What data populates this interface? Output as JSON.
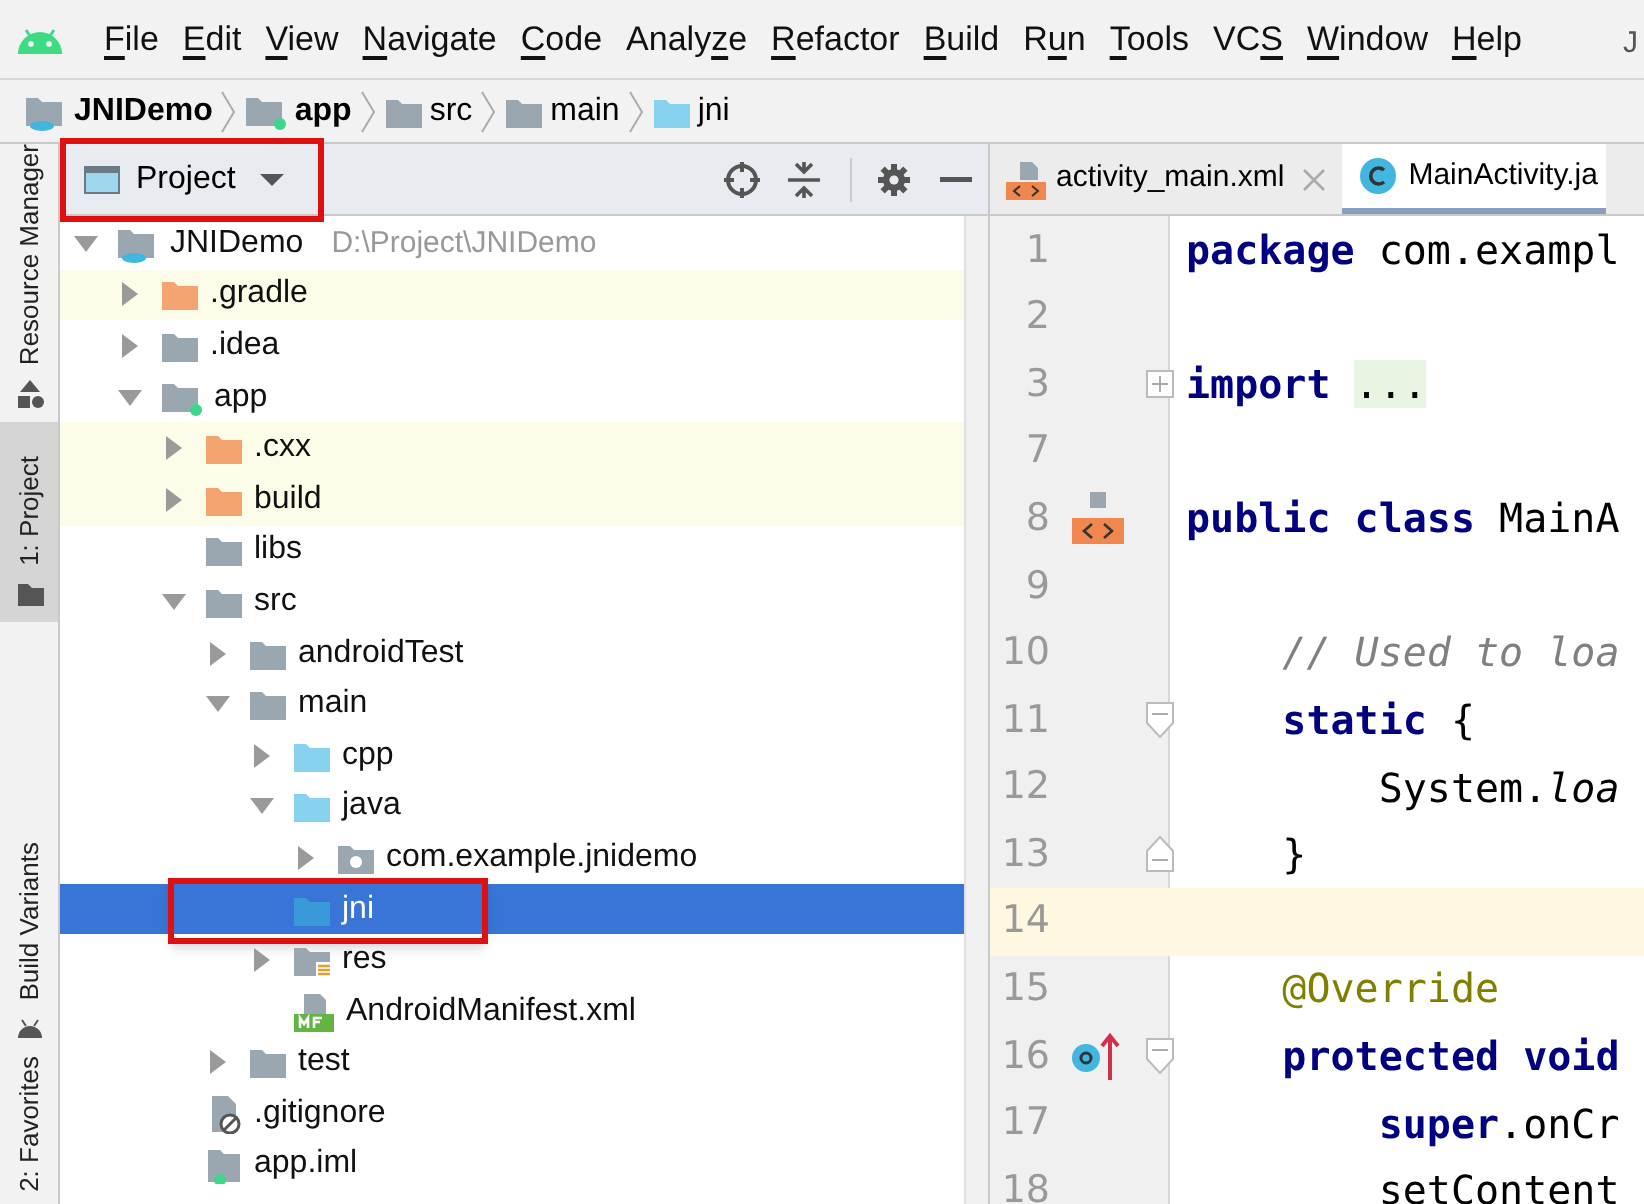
{
  "menu_bar": {
    "items": [
      {
        "parts": [
          {
            "text": "F",
            "underlined": true
          },
          {
            "text": "ile",
            "underlined": false
          }
        ]
      },
      {
        "parts": [
          {
            "text": "E",
            "underlined": true
          },
          {
            "text": "dit",
            "underlined": false
          }
        ]
      },
      {
        "parts": [
          {
            "text": "V",
            "underlined": true
          },
          {
            "text": "iew",
            "underlined": false
          }
        ]
      },
      {
        "parts": [
          {
            "text": "N",
            "underlined": true
          },
          {
            "text": "avigate",
            "underlined": false
          }
        ]
      },
      {
        "parts": [
          {
            "text": "C",
            "underlined": true
          },
          {
            "text": "ode",
            "underlined": false
          }
        ]
      },
      {
        "parts": [
          {
            "text": "Analy",
            "underlined": false
          },
          {
            "text": "z",
            "underlined": true
          },
          {
            "text": "e",
            "underlined": false
          }
        ]
      },
      {
        "parts": [
          {
            "text": "R",
            "underlined": true
          },
          {
            "text": "efactor",
            "underlined": false
          }
        ]
      },
      {
        "parts": [
          {
            "text": "B",
            "underlined": true
          },
          {
            "text": "uild",
            "underlined": false
          }
        ]
      },
      {
        "parts": [
          {
            "text": "R",
            "underlined": false
          },
          {
            "text": "u",
            "underlined": true
          },
          {
            "text": "n",
            "underlined": false
          }
        ]
      },
      {
        "parts": [
          {
            "text": "T",
            "underlined": true
          },
          {
            "text": "ools",
            "underlined": false
          }
        ]
      },
      {
        "parts": [
          {
            "text": "VC",
            "underlined": false
          },
          {
            "text": "S",
            "underlined": true
          }
        ]
      },
      {
        "parts": [
          {
            "text": "W",
            "underlined": true
          },
          {
            "text": "indow",
            "underlined": false
          }
        ]
      },
      {
        "parts": [
          {
            "text": "H",
            "underlined": true
          },
          {
            "text": "elp",
            "underlined": false
          }
        ]
      }
    ],
    "title_fragment": "J"
  },
  "breadcrumb": [
    {
      "label": "JNIDemo",
      "kind": "project",
      "bold": true
    },
    {
      "label": "app",
      "kind": "module",
      "bold": true
    },
    {
      "label": "src",
      "kind": "folder",
      "bold": false
    },
    {
      "label": "main",
      "kind": "folder",
      "bold": false
    },
    {
      "label": "jni",
      "kind": "source",
      "bold": false
    }
  ],
  "left_stripe": [
    {
      "label": "Resource Manager",
      "kind": "shapes",
      "selected": false
    },
    {
      "label": "1: Project",
      "kind": "folder",
      "selected": true
    },
    {
      "label": "Build Variants",
      "kind": "android",
      "selected": false
    },
    {
      "label": "2: Favorites",
      "selected": false
    }
  ],
  "project_panel": {
    "view": "Project",
    "highlighted": true,
    "tree": [
      {
        "label": "JNIDemo",
        "path": "D:\\Project\\JNIDemo",
        "kind": "project",
        "expanded": true,
        "selected": false,
        "children": [
          {
            "label": ".gradle",
            "kind": "excluded",
            "expanded": false,
            "selected": false,
            "excluded": true
          },
          {
            "label": ".idea",
            "kind": "folder",
            "expanded": false,
            "selected": false
          },
          {
            "label": "app",
            "kind": "module",
            "expanded": true,
            "selected": false,
            "children": [
              {
                "label": ".cxx",
                "kind": "excluded",
                "expanded": false,
                "selected": false,
                "excluded": true
              },
              {
                "label": "build",
                "kind": "excluded",
                "expanded": false,
                "selected": false,
                "excluded": true
              },
              {
                "label": "libs",
                "kind": "folder",
                "selected": false
              },
              {
                "label": "src",
                "kind": "folder",
                "expanded": true,
                "selected": false,
                "children": [
                  {
                    "label": "androidTest",
                    "kind": "folder",
                    "expanded": false,
                    "selected": false
                  },
                  {
                    "label": "main",
                    "kind": "folder",
                    "expanded": true,
                    "selected": false,
                    "children": [
                      {
                        "label": "cpp",
                        "kind": "source",
                        "expanded": false,
                        "selected": false
                      },
                      {
                        "label": "java",
                        "kind": "source",
                        "expanded": true,
                        "selected": false,
                        "children": [
                          {
                            "label": "com.example.jnidemo",
                            "kind": "package",
                            "expanded": false,
                            "selected": false
                          }
                        ]
                      },
                      {
                        "label": "jni",
                        "kind": "source",
                        "selected": true,
                        "highlighted": true
                      },
                      {
                        "label": "res",
                        "kind": "resources",
                        "expanded": false,
                        "selected": false
                      },
                      {
                        "label": "AndroidManifest.xml",
                        "kind": "manifest",
                        "selected": false
                      }
                    ]
                  },
                  {
                    "label": "test",
                    "kind": "folder",
                    "expanded": false,
                    "selected": false
                  }
                ]
              },
              {
                "label": ".gitignore",
                "kind": "gitignore",
                "selected": false
              },
              {
                "label": "app.iml",
                "kind": "iml",
                "selected": false
              }
            ]
          }
        ]
      }
    ]
  },
  "editor": {
    "tabs": [
      {
        "label": "activity_main.xml",
        "kind": "layout",
        "selected": false,
        "closable": true
      },
      {
        "label": "MainActivity.ja",
        "kind": "class",
        "selected": true,
        "closable": false
      }
    ],
    "lines": [
      {
        "number": "1",
        "tokens": [
          {
            "kind": "keyword",
            "text": "package"
          },
          {
            "kind": "plain",
            "text": " com.exampl"
          }
        ]
      },
      {
        "number": "2"
      },
      {
        "number": "3",
        "fold_marker": {
          "kind": "expand"
        },
        "tokens": [
          {
            "kind": "keyword",
            "text": "import "
          },
          {
            "kind": "folded",
            "text": "..."
          }
        ]
      },
      {
        "number": "7"
      },
      {
        "number": "8",
        "gutter_icon": {
          "kind": "layout"
        },
        "tokens": [
          {
            "kind": "keyword",
            "text": "public class"
          },
          {
            "kind": "plain",
            "text": " MainA"
          }
        ]
      },
      {
        "number": "9"
      },
      {
        "number": "10",
        "tokens": [
          {
            "kind": "comment",
            "text": "    // Used to loa"
          }
        ]
      },
      {
        "number": "11",
        "fold_marker": {
          "kind": "collapse"
        },
        "tokens": [
          {
            "kind": "keyword",
            "text": "    static"
          },
          {
            "kind": "plain",
            "text": " {"
          }
        ]
      },
      {
        "number": "12",
        "tokens": [
          {
            "kind": "plain",
            "text": "        System."
          },
          {
            "kind": "static_call",
            "text": "loa"
          }
        ]
      },
      {
        "number": "13",
        "fold_marker": {
          "kind": "end"
        },
        "tokens": [
          {
            "kind": "plain",
            "text": "    }"
          }
        ]
      },
      {
        "number": "14",
        "current": true
      },
      {
        "number": "15",
        "tokens": [
          {
            "kind": "annotation",
            "text": "    @Override"
          }
        ]
      },
      {
        "number": "16",
        "gutter_icon": {
          "kind": "override"
        },
        "fold_marker": {
          "kind": "collapse"
        },
        "tokens": [
          {
            "kind": "keyword",
            "text": "    protected void"
          }
        ]
      },
      {
        "number": "17",
        "tokens": [
          {
            "kind": "keyword",
            "text": "        super"
          },
          {
            "kind": "plain",
            "text": ".onCr"
          }
        ]
      },
      {
        "number": "18",
        "tokens": [
          {
            "kind": "plain",
            "text": "        setContent"
          }
        ]
      }
    ]
  }
}
